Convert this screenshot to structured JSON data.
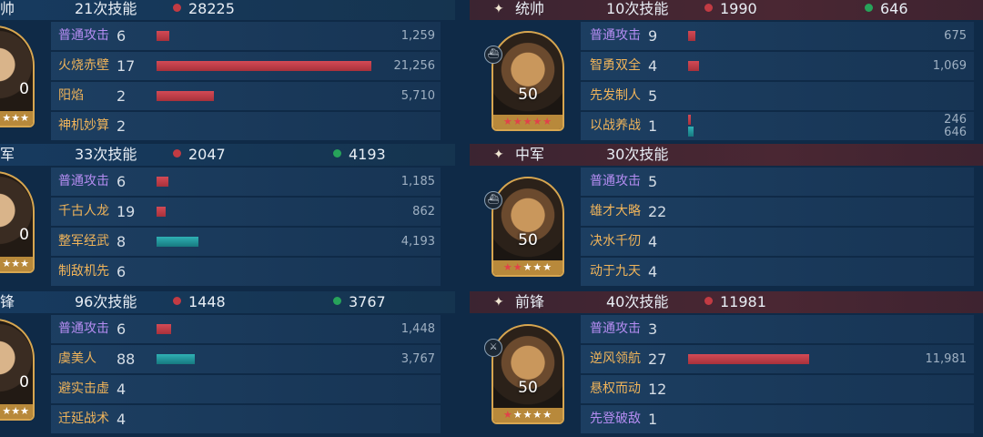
{
  "left": [
    {
      "role": "帅",
      "skills": "21次技能",
      "red": "28225",
      "green": "",
      "level": "0",
      "stars": "★★★",
      "rows": [
        {
          "name": "普通攻击",
          "color": "purple",
          "count": "6",
          "bar": "red",
          "ratio": 0.059,
          "value": "1,259"
        },
        {
          "name": "火烧赤壁",
          "color": "orange",
          "count": "17",
          "bar": "red",
          "ratio": 1.0,
          "value": "21,256"
        },
        {
          "name": "阳焰",
          "color": "orange",
          "count": "2",
          "bar": "red",
          "ratio": 0.269,
          "value": "5,710"
        },
        {
          "name": "神机妙算",
          "color": "orange",
          "count": "2",
          "bar": "",
          "ratio": 0,
          "value": ""
        }
      ]
    },
    {
      "role": "军",
      "skills": "33次技能",
      "red": "2047",
      "green": "4193",
      "level": "0",
      "stars": "★★★",
      "rows": [
        {
          "name": "普通攻击",
          "color": "purple",
          "count": "6",
          "bar": "red",
          "ratio": 0.056,
          "value": "1,185"
        },
        {
          "name": "千古人龙",
          "color": "orange",
          "count": "19",
          "bar": "red",
          "ratio": 0.041,
          "value": "862"
        },
        {
          "name": "整军经武",
          "color": "orange",
          "count": "8",
          "bar": "teal",
          "ratio": 0.197,
          "value": "4,193"
        },
        {
          "name": "制敌机先",
          "color": "orange",
          "count": "6",
          "bar": "",
          "ratio": 0,
          "value": ""
        }
      ]
    },
    {
      "role": "锋",
      "skills": "96次技能",
      "red": "1448",
      "green": "3767",
      "level": "0",
      "stars": "★★★",
      "rows": [
        {
          "name": "普通攻击",
          "color": "purple",
          "count": "6",
          "bar": "red",
          "ratio": 0.068,
          "value": "1,448"
        },
        {
          "name": "虞美人",
          "color": "orange",
          "count": "88",
          "bar": "teal",
          "ratio": 0.177,
          "value": "3,767"
        },
        {
          "name": "避实击虚",
          "color": "orange",
          "count": "4",
          "bar": "",
          "ratio": 0,
          "value": ""
        },
        {
          "name": "迁延战术",
          "color": "orange",
          "count": "4",
          "bar": "",
          "ratio": 0,
          "value": ""
        }
      ]
    }
  ],
  "right": [
    {
      "role": "统帅",
      "skills": "10次技能",
      "red": "1990",
      "green": "646",
      "level": "50",
      "stars_red": "★★★★★",
      "stars_white": "",
      "badge": "⛴",
      "rows": [
        {
          "name": "普通攻击",
          "color": "purple",
          "count": "9",
          "bar": "red",
          "ratio": 0.032,
          "value": "675"
        },
        {
          "name": "智勇双全",
          "color": "orange",
          "count": "4",
          "bar": "red",
          "ratio": 0.05,
          "value": "1,069"
        },
        {
          "name": "先发制人",
          "color": "orange",
          "count": "5",
          "bar": "",
          "ratio": 0,
          "value": ""
        },
        {
          "name": "以战养战",
          "color": "orange",
          "count": "1",
          "bar": "dual",
          "ratio": 0.012,
          "value": "246",
          "value2": "646"
        }
      ]
    },
    {
      "role": "中军",
      "skills": "30次技能",
      "red": "",
      "green": "",
      "level": "50",
      "stars_red": "★★",
      "stars_white": "★★★",
      "badge": "⛴",
      "rows": [
        {
          "name": "普通攻击",
          "color": "purple",
          "count": "5",
          "bar": "",
          "ratio": 0,
          "value": ""
        },
        {
          "name": "雄才大略",
          "color": "orange",
          "count": "22",
          "bar": "",
          "ratio": 0,
          "value": ""
        },
        {
          "name": "决水千仞",
          "color": "orange",
          "count": "4",
          "bar": "",
          "ratio": 0,
          "value": ""
        },
        {
          "name": "动于九天",
          "color": "orange",
          "count": "4",
          "bar": "",
          "ratio": 0,
          "value": ""
        }
      ]
    },
    {
      "role": "前锋",
      "skills": "40次技能",
      "red": "11981",
      "green": "",
      "level": "50",
      "stars_red": "★",
      "stars_white": "★★★★",
      "badge": "⚔",
      "rows": [
        {
          "name": "普通攻击",
          "color": "purple",
          "count": "3",
          "bar": "",
          "ratio": 0,
          "value": ""
        },
        {
          "name": "逆风领航",
          "color": "orange",
          "count": "27",
          "bar": "red",
          "ratio": 0.564,
          "value": "11,981"
        },
        {
          "name": "悬权而动",
          "color": "orange",
          "count": "12",
          "bar": "",
          "ratio": 0,
          "value": ""
        },
        {
          "name": "先登破敌",
          "color": "purple",
          "count": "1",
          "bar": "",
          "ratio": 0,
          "value": ""
        }
      ]
    }
  ]
}
